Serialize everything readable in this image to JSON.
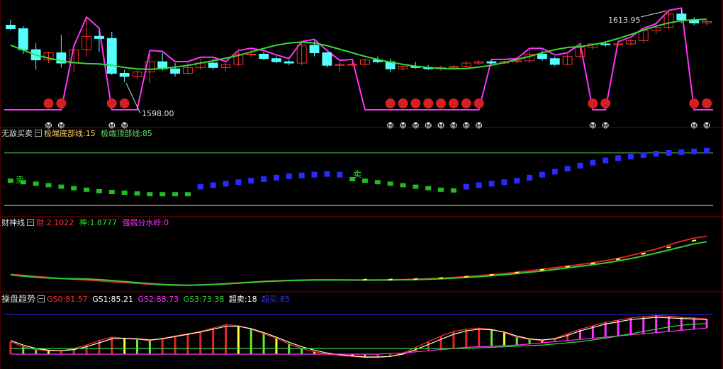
{
  "colors": {
    "bg": "#000000",
    "divider": "#8a0000",
    "up": "#ff3030",
    "down": "#55ffff",
    "magenta": "#ff33ff",
    "green": "#33dd33",
    "blue": "#2a2aff",
    "yellow": "#ffff33",
    "white": "#ffffff",
    "gray": "#c0c0c0"
  },
  "icons": {
    "collapse": "minus-box-icon",
    "marker": "circle-m-icon"
  },
  "panel1": {
    "price_high_label": "1613.95",
    "price_low_label": "1598.00"
  },
  "panel2": {
    "name": "无敌买卖",
    "l1": "极端底部线:",
    "v1": "15",
    "l2": "极端顶部线:",
    "v2": "85",
    "sell_marks": [
      "卖",
      "卖"
    ]
  },
  "panel3": {
    "name": "财神线",
    "l1": "财:",
    "v1": "2.1022",
    "l2": "神:",
    "v2": "1.8777",
    "l3": "强弱分水岭:",
    "v3": "0"
  },
  "panel4": {
    "name": "操盘趋势",
    "l1": "GS0:",
    "v1": "81.57",
    "l2": "GS1:",
    "v2": "85.21",
    "l3": "GS2:",
    "v3": "88.73",
    "l4": "GS3:",
    "v4": "73.38",
    "l5": "超卖:",
    "v5": "18",
    "l6": "超买:",
    "v6": "85"
  },
  "chart_data": [
    {
      "type": "candlestick",
      "n": 56,
      "ohlc": [
        [
          1611.0,
          1612.2,
          1609.8,
          1610.2
        ],
        [
          1610.2,
          1610.8,
          1604.5,
          1605.5
        ],
        [
          1605.5,
          1607.0,
          1601.0,
          1603.2
        ],
        [
          1603.2,
          1605.0,
          1602.5,
          1604.8
        ],
        [
          1604.8,
          1608.8,
          1601.5,
          1602.5
        ],
        [
          1602.5,
          1606.0,
          1600.5,
          1605.5
        ],
        [
          1605.5,
          1612.5,
          1604.0,
          1608.5
        ],
        [
          1608.5,
          1610.0,
          1605.0,
          1608.0
        ],
        [
          1608.0,
          1609.5,
          1599.8,
          1600.2
        ],
        [
          1600.2,
          1601.0,
          1598.2,
          1599.5
        ],
        [
          1599.5,
          1601.0,
          1598.8,
          1600.5
        ],
        [
          1600.5,
          1605.0,
          1598.0,
          1602.8
        ],
        [
          1602.8,
          1604.8,
          1600.8,
          1601.2
        ],
        [
          1601.2,
          1602.5,
          1599.5,
          1600.2
        ],
        [
          1600.2,
          1602.5,
          1600.0,
          1601.5
        ],
        [
          1601.5,
          1603.5,
          1601.0,
          1602.5
        ],
        [
          1602.5,
          1603.5,
          1601.0,
          1601.5
        ],
        [
          1601.5,
          1602.5,
          1600.5,
          1602.2
        ],
        [
          1602.2,
          1605.0,
          1601.8,
          1604.5
        ],
        [
          1604.5,
          1605.5,
          1603.8,
          1604.5
        ],
        [
          1604.5,
          1605.0,
          1603.2,
          1603.5
        ],
        [
          1603.5,
          1604.0,
          1602.5,
          1602.8
        ],
        [
          1602.8,
          1603.2,
          1602.0,
          1602.5
        ],
        [
          1602.5,
          1607.0,
          1602.0,
          1606.5
        ],
        [
          1606.5,
          1607.5,
          1604.0,
          1604.8
        ],
        [
          1604.8,
          1605.0,
          1601.5,
          1602.0
        ],
        [
          1602.0,
          1602.8,
          1600.5,
          1602.2
        ],
        [
          1602.2,
          1603.0,
          1601.8,
          1602.2
        ],
        [
          1602.2,
          1603.5,
          1602.0,
          1603.2
        ],
        [
          1603.2,
          1604.0,
          1602.5,
          1602.8
        ],
        [
          1602.8,
          1603.5,
          1600.5,
          1601.2
        ],
        [
          1601.2,
          1602.0,
          1600.8,
          1601.8
        ],
        [
          1601.8,
          1602.8,
          1601.2,
          1601.5
        ],
        [
          1601.5,
          1602.0,
          1601.0,
          1601.2
        ],
        [
          1601.2,
          1602.0,
          1600.8,
          1601.5
        ],
        [
          1601.5,
          1602.0,
          1601.2,
          1601.8
        ],
        [
          1601.8,
          1603.0,
          1601.5,
          1602.5
        ],
        [
          1602.5,
          1603.2,
          1602.0,
          1602.8
        ],
        [
          1602.8,
          1603.0,
          1602.3,
          1602.5
        ],
        [
          1602.5,
          1603.0,
          1602.2,
          1602.8
        ],
        [
          1602.8,
          1603.2,
          1602.5,
          1603.0
        ],
        [
          1603.0,
          1605.5,
          1602.5,
          1604.5
        ],
        [
          1604.5,
          1605.5,
          1603.0,
          1603.5
        ],
        [
          1603.5,
          1604.0,
          1601.8,
          1602.2
        ],
        [
          1602.2,
          1604.5,
          1602.0,
          1604.0
        ],
        [
          1604.0,
          1606.5,
          1603.5,
          1606.0
        ],
        [
          1606.0,
          1607.0,
          1605.5,
          1606.8
        ],
        [
          1606.8,
          1607.2,
          1606.2,
          1606.6
        ],
        [
          1606.6,
          1607.0,
          1606.2,
          1606.8
        ],
        [
          1606.8,
          1608.0,
          1606.5,
          1607.5
        ],
        [
          1607.5,
          1610.0,
          1607.0,
          1609.8
        ],
        [
          1609.8,
          1611.0,
          1609.0,
          1610.5
        ],
        [
          1610.5,
          1614.0,
          1610.0,
          1613.5
        ],
        [
          1613.5,
          1614.5,
          1611.5,
          1612.2
        ],
        [
          1612.2,
          1612.8,
          1611.0,
          1611.5
        ],
        [
          1611.5,
          1612.0,
          1611.0,
          1611.8
        ]
      ],
      "ma": [
        1606.5,
        1605.4,
        1604.3,
        1603.6,
        1603.0,
        1602.6,
        1602.4,
        1602.3,
        1602.0,
        1601.5,
        1601.2,
        1601.1,
        1601.3,
        1601.6,
        1602.0,
        1602.5,
        1603.0,
        1603.6,
        1604.2,
        1605.0,
        1605.8,
        1606.5,
        1607.0,
        1607.2,
        1607.0,
        1606.4,
        1605.6,
        1604.8,
        1604.0,
        1603.3,
        1602.7,
        1602.2,
        1601.8,
        1601.5,
        1601.3,
        1601.2,
        1601.3,
        1601.6,
        1602.0,
        1602.6,
        1603.3,
        1604.0,
        1604.8,
        1605.5,
        1606.0,
        1606.2,
        1606.6,
        1607.2,
        1608.0,
        1608.9,
        1609.9,
        1610.8,
        1611.5,
        1612.0,
        1612.2,
        1612.3
      ],
      "signal": [
        0,
        0,
        0,
        0,
        0,
        1,
        1,
        1,
        0,
        0,
        0,
        1,
        1,
        1,
        1,
        1,
        1,
        1,
        1,
        1,
        1,
        1,
        1,
        1,
        1,
        1,
        1,
        1,
        0,
        0,
        0,
        0,
        0,
        0,
        0,
        0,
        0,
        0,
        1,
        1,
        1,
        1,
        1,
        1,
        1,
        1,
        0,
        0,
        1,
        1,
        1,
        1,
        1,
        1,
        0,
        0
      ],
      "markers": [
        3,
        4,
        5,
        6,
        7,
        8,
        9,
        11,
        12,
        13,
        14,
        15,
        16,
        17,
        18,
        19,
        20,
        21,
        22,
        23,
        24,
        25,
        26,
        27,
        30,
        31,
        32,
        33,
        34,
        35,
        36,
        37,
        38,
        39,
        40,
        41,
        42,
        43,
        44,
        45,
        46,
        47,
        48,
        49,
        50,
        51,
        52,
        53,
        54,
        55
      ],
      "yrange": [
        1596.0,
        1616.0
      ]
    },
    {
      "type": "bar",
      "name_key": "panel2",
      "n": 56,
      "up_values": [
        null,
        null,
        null,
        null,
        null,
        null,
        null,
        null,
        null,
        null,
        null,
        null,
        null,
        null,
        null,
        40,
        42,
        44,
        46,
        48,
        50,
        52,
        54,
        55,
        56,
        57,
        56,
        null,
        null,
        null,
        null,
        null,
        null,
        null,
        null,
        null,
        40,
        42,
        44,
        46,
        48,
        52,
        56,
        60,
        64,
        68,
        72,
        75,
        78,
        80,
        82,
        84,
        85,
        86,
        87,
        88
      ],
      "down_values": [
        48,
        46,
        44,
        42,
        40,
        38,
        36,
        34,
        33,
        32,
        31,
        30,
        30,
        30,
        30,
        null,
        null,
        null,
        null,
        null,
        null,
        null,
        null,
        null,
        null,
        null,
        null,
        50,
        48,
        46,
        44,
        42,
        40,
        38,
        36,
        35,
        34,
        33,
        null,
        null,
        null,
        null,
        null,
        null,
        null,
        null,
        null,
        null,
        null,
        null,
        null,
        null,
        null,
        null,
        null,
        null
      ],
      "levels": [
        15,
        85
      ],
      "sell_at": [
        1,
        28
      ],
      "yrange": [
        0,
        100
      ]
    },
    {
      "type": "line",
      "n": 56,
      "series": [
        {
          "values": [
            0.62,
            0.58,
            0.54,
            0.5,
            0.46,
            0.43,
            0.4,
            0.37,
            0.33,
            0.3,
            0.27,
            0.24,
            0.22,
            0.2,
            0.2,
            0.21,
            0.23,
            0.26,
            0.29,
            0.32,
            0.35,
            0.37,
            0.39,
            0.4,
            0.41,
            0.41,
            0.41,
            0.4,
            0.4,
            0.4,
            0.41,
            0.42,
            0.43,
            0.45,
            0.47,
            0.5,
            0.53,
            0.57,
            0.61,
            0.65,
            0.7,
            0.76,
            0.82,
            0.88,
            0.94,
            1.0,
            1.07,
            1.15,
            1.24,
            1.35,
            1.47,
            1.6,
            1.75,
            1.9,
            2.02,
            2.1
          ]
        },
        {
          "values": [
            0.6,
            0.55,
            0.51,
            0.48,
            0.46,
            0.45,
            0.44,
            0.42,
            0.38,
            0.34,
            0.3,
            0.26,
            0.23,
            0.21,
            0.2,
            0.21,
            0.23,
            0.25,
            0.28,
            0.31,
            0.34,
            0.36,
            0.38,
            0.39,
            0.4,
            0.4,
            0.4,
            0.4,
            0.4,
            0.4,
            0.4,
            0.41,
            0.42,
            0.43,
            0.45,
            0.47,
            0.5,
            0.53,
            0.57,
            0.61,
            0.65,
            0.7,
            0.75,
            0.81,
            0.87,
            0.93,
            0.99,
            1.06,
            1.14,
            1.23,
            1.33,
            1.44,
            1.56,
            1.68,
            1.8,
            1.88
          ]
        }
      ],
      "yrange": [
        0.0,
        2.3
      ]
    },
    {
      "type": "line",
      "n": 56,
      "series": [
        {
          "values": [
            42,
            33,
            28,
            26,
            26,
            30,
            36,
            44,
            50,
            48,
            46,
            44,
            48,
            52,
            56,
            60,
            66,
            72,
            70,
            64,
            56,
            48,
            38,
            30,
            24,
            20,
            18,
            16,
            14,
            14,
            16,
            22,
            32,
            42,
            52,
            60,
            64,
            66,
            64,
            58,
            50,
            46,
            44,
            48,
            56,
            64,
            70,
            76,
            80,
            84,
            86,
            88,
            87,
            85,
            84,
            82
          ]
        },
        {
          "values": [
            44,
            36,
            30,
            27,
            26,
            28,
            33,
            40,
            47,
            48,
            47,
            45,
            47,
            51,
            55,
            59,
            64,
            69,
            69,
            65,
            58,
            50,
            41,
            33,
            27,
            22,
            19,
            17,
            15,
            15,
            16,
            20,
            28,
            37,
            46,
            55,
            61,
            64,
            63,
            59,
            52,
            47,
            45,
            47,
            53,
            61,
            67,
            73,
            77,
            81,
            83,
            85,
            84,
            83,
            82,
            81
          ]
        },
        {
          "values": [
            20,
            20,
            20,
            20,
            20,
            20,
            20,
            20,
            20,
            20,
            20,
            20,
            20,
            20,
            20,
            20,
            20,
            20,
            20,
            20,
            20,
            20,
            20,
            20,
            20,
            20,
            20,
            20,
            20,
            20,
            21,
            22,
            24,
            26,
            28,
            30,
            32,
            33,
            34,
            35,
            36,
            38,
            40,
            42,
            44,
            46,
            48,
            50,
            52,
            54,
            56,
            58,
            60,
            62,
            64,
            66
          ]
        },
        {
          "values": [
            30,
            30,
            30,
            30,
            30,
            30,
            30,
            30,
            30,
            30,
            30,
            30,
            30,
            30,
            30,
            30,
            30,
            30,
            30,
            30,
            30,
            30,
            30,
            30,
            30,
            30,
            30,
            30,
            30,
            30,
            30,
            30,
            30,
            30,
            30,
            30,
            30,
            31,
            32,
            33,
            34,
            35,
            36,
            38,
            40,
            42,
            45,
            48,
            52,
            56,
            60,
            64,
            68,
            71,
            73,
            74
          ]
        }
      ],
      "levels": [
        18,
        85
      ],
      "yrange": [
        0,
        100
      ]
    }
  ]
}
